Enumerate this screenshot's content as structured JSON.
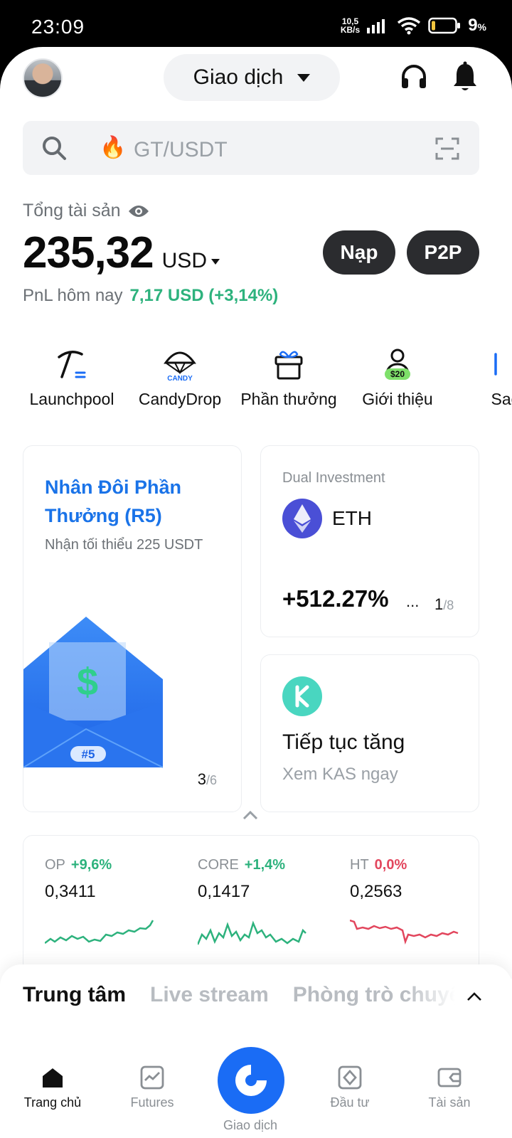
{
  "status_bar": {
    "time": "23:09",
    "net_speed_value": "10,5",
    "net_speed_unit": "KB/s",
    "battery_percent": "9",
    "battery_unit": "%"
  },
  "header": {
    "mode_label": "Giao dịch"
  },
  "search": {
    "placeholder": "GT/USDT"
  },
  "assets": {
    "label": "Tổng tài sản",
    "amount": "235,32",
    "currency": "USD",
    "deposit_label": "Nạp",
    "p2p_label": "P2P",
    "pnl_label": "PnL hôm nay",
    "pnl_value": "7,17 USD (+3,14%)"
  },
  "shortcuts": [
    {
      "label": "Launchpool",
      "icon": "pickaxe-icon"
    },
    {
      "label": "CandyDrop",
      "icon": "candy-parachute-icon"
    },
    {
      "label": "Phần thưởng",
      "icon": "gift-icon"
    },
    {
      "label": "Giới thiệu",
      "icon": "referral-icon",
      "badge": "$20"
    },
    {
      "label": "Sao",
      "icon": "star-icon"
    }
  ],
  "candy_badge": "CANDY",
  "promo_card": {
    "title": "Nhân Đôi Phần Thưởng (R5)",
    "subtitle": "Nhận tối thiểu 225 USDT",
    "badge": "#5",
    "page_current": "3",
    "page_total": "/6"
  },
  "dual_card": {
    "label": "Dual Investment",
    "asset": "ETH",
    "apr": "+512.27%",
    "ellipsis": "...",
    "page_current": "1",
    "page_total": "/8"
  },
  "kas_card": {
    "title": "Tiếp tục tăng",
    "subtitle": "Xem KAS ngay"
  },
  "tickers": [
    {
      "symbol": "OP",
      "change": "+9,6%",
      "price": "0,3411",
      "trend": "up",
      "color": "#2db27d"
    },
    {
      "symbol": "CORE",
      "change": "+1,4%",
      "price": "0,1417",
      "trend": "up",
      "color": "#2db27d"
    },
    {
      "symbol": "HT",
      "change": "0,0%",
      "price": "0,2563",
      "trend": "flat",
      "color": "#e2465d"
    }
  ],
  "feed_tabs": [
    "Trung tâm",
    "Live stream",
    "Phòng trò chuyện"
  ],
  "bottom_nav": [
    {
      "label": "Trang chủ",
      "icon": "home-icon"
    },
    {
      "label": "Futures",
      "icon": "futures-chart-icon"
    },
    {
      "label": "Giao dịch",
      "icon": "gate-logo-icon"
    },
    {
      "label": "Đầu tư",
      "icon": "invest-icon"
    },
    {
      "label": "Tài sản",
      "icon": "wallet-icon"
    }
  ],
  "colors": {
    "accent_blue": "#1a6cf5",
    "positive_green": "#2db27d",
    "negative_red": "#e2465d",
    "dark_button": "#2b2c2f"
  }
}
